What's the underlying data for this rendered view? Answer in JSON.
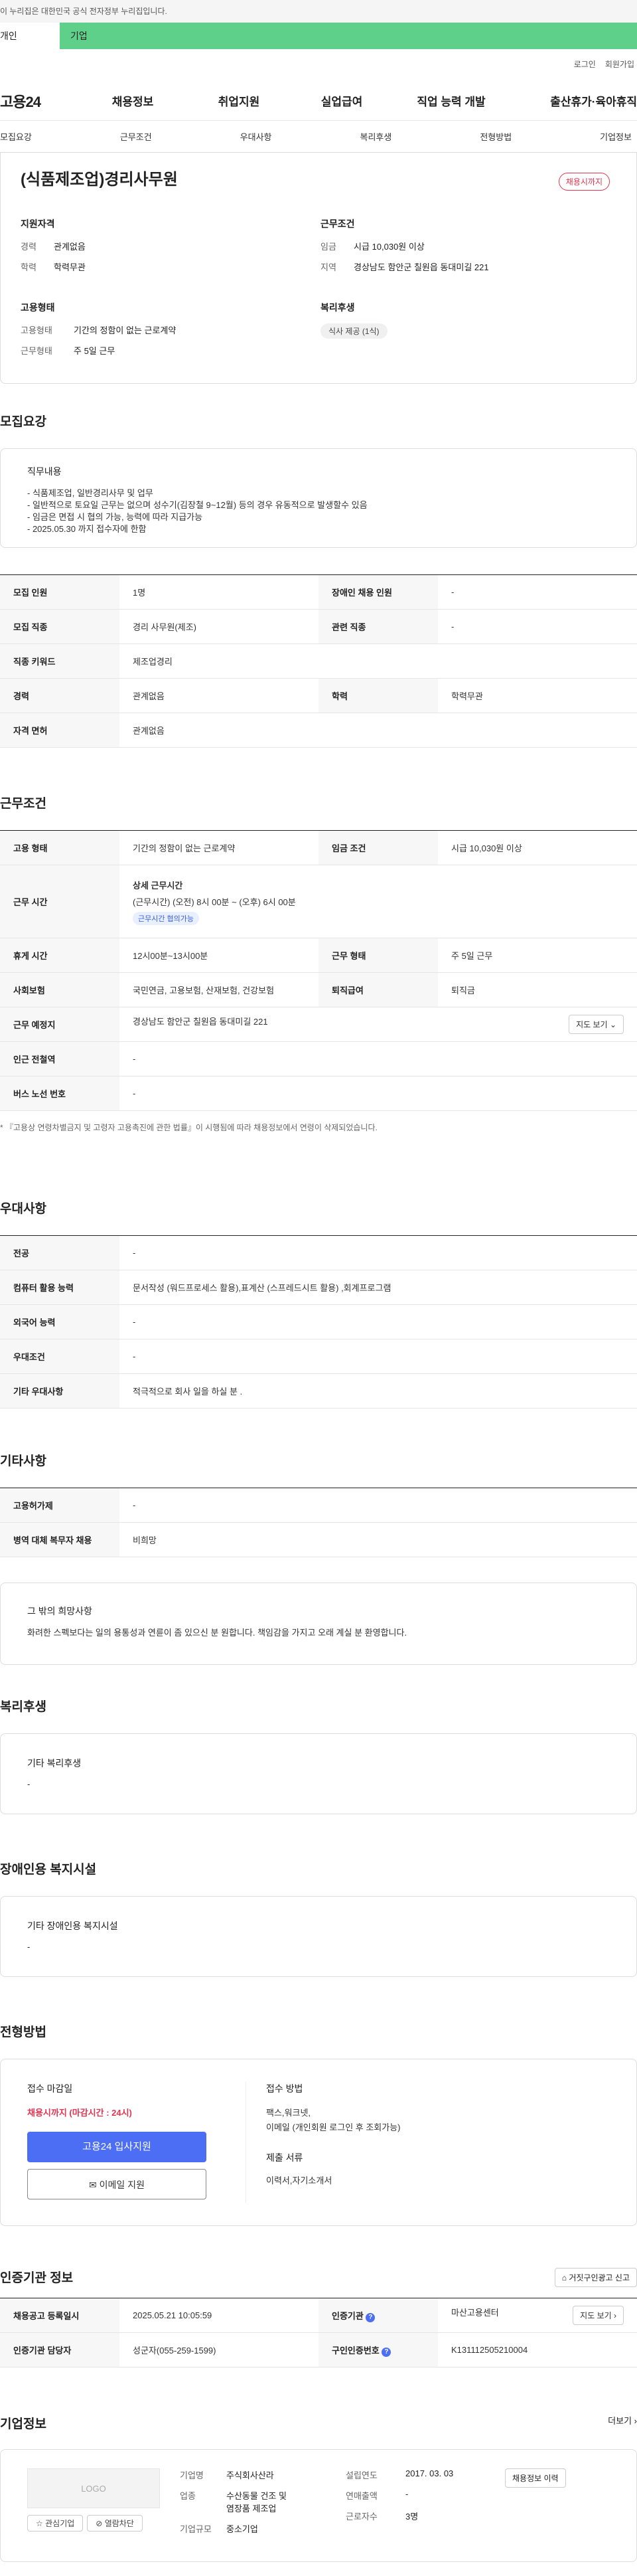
{
  "gov_banner": "이 누리집은 대한민국 공식 전자정부 누리집입니다.",
  "tabs": {
    "individual": "개인",
    "enterprise": "기업"
  },
  "util": {
    "login": "로그인",
    "join": "회원가입"
  },
  "gnb": {
    "logo": "고용24",
    "items": [
      "채용정보",
      "취업지원",
      "실업급여",
      "직업 능력 개발",
      "출산휴가·육아휴직"
    ]
  },
  "subnav": [
    "모집요강",
    "근무조건",
    "우대사항",
    "복리후생",
    "전형방법",
    "기업정보"
  ],
  "job": {
    "title": "(식품제조업)경리사무원",
    "badge": "채용시까지"
  },
  "summary": {
    "qual_h": "지원자격",
    "career_k": "경력",
    "career_v": "관계없음",
    "edu_k": "학력",
    "edu_v": "학력무관",
    "work_h": "근무조건",
    "wage_k": "임금",
    "wage_v": "시급 10,030원 이상",
    "area_k": "지역",
    "area_v": "경상남도 함안군 칠원읍 동대미길 221",
    "emp_h": "고용형태",
    "type_k": "고용형태",
    "type_v": "기간의 정함이 없는 근로계약",
    "form_k": "근무형태",
    "form_v": "주 5일 근무",
    "welfare_h": "복리후생",
    "welfare_chip": "식사 제공 (1식)"
  },
  "recruit": {
    "h": "모집요강",
    "duty_h": "직무내용",
    "duty_lines": [
      "- 식품제조업, 일반경리사무 및 업무",
      "- 일반적으로 토요일 근무는 없으며 성수기(김장철 9~12월) 등의 경우 유동적으로 발생할수 있음",
      "- 임금은 면접 시 협의 가능, 능력에 따라 지급가능",
      "- 2025.05.30 까지 접수자에 한함"
    ],
    "rows": [
      {
        "k1": "모집 인원",
        "v1": "1명",
        "k2": "장애인 채용 인원",
        "v2": "-"
      },
      {
        "k1": "모집 직종",
        "v1": "경리 사무원(제조)",
        "k2": "관련 직종",
        "v2": "-"
      },
      {
        "k1": "직종 키워드",
        "v1": "제조업경리"
      },
      {
        "k1": "경력",
        "v1": "관계없음",
        "k2": "학력",
        "v2": "학력무관"
      },
      {
        "k1": "자격 면허",
        "v1": "관계없음"
      }
    ]
  },
  "conditions": {
    "h": "근무조건",
    "type_k": "고용 형태",
    "type_v": "기간의 정함이 없는 근로계약",
    "wage_k": "임금 조건",
    "wage_v": "시급 10,030원 이상",
    "time_k": "근무 시간",
    "time_h": "상세 근무시간",
    "time_v": "(근무시간) (오전) 8시 00분 ~ (오후) 6시 00분",
    "time_chip": "근무시간 협의가능",
    "rest_k": "휴게 시간",
    "rest_v": "12시00분~13시00분",
    "form_k": "근무 형태",
    "form_v": "주 5일 근무",
    "ins_k": "사회보험",
    "ins_v": "국민연금, 고용보험, 산재보험, 건강보험",
    "ret_k": "퇴직급여",
    "ret_v": "퇴직금",
    "place_k": "근무 예정지",
    "place_v": "경상남도 함안군 칠원읍 동대미길 221",
    "map_btn": "지도 보기",
    "sub_k": "인근 전철역",
    "sub_v": "-",
    "bus_k": "버스 노선 번호",
    "bus_v": "-",
    "note": "* 『고용상 연령차별금지 및 고령자 고용촉진에 관한 법률』이 시행됨에 따라 채용정보에서 연령이 삭제되었습니다."
  },
  "pref": {
    "h": "우대사항",
    "rows": [
      {
        "k": "전공",
        "v": "-"
      },
      {
        "k": "컴퓨터 활용 능력",
        "v": "문서작성 (워드프로세스 활용),표계산 (스프레드시트 활용) ,회계프로그램"
      },
      {
        "k": "외국어 능력",
        "v": "-"
      },
      {
        "k": "우대조건",
        "v": "-"
      },
      {
        "k": "기타 우대사항",
        "v": "적극적으로 회사 일을 하실 분 ."
      }
    ]
  },
  "etc": {
    "h": "기타사항",
    "rows": [
      {
        "k": "고용허가제",
        "v": "-"
      },
      {
        "k": "병역 대체 복무자 채용",
        "v": "비희망"
      }
    ],
    "wish_h": "그 밖의 희망사항",
    "wish_v": "화려한 스펙보다는 일의 용통성과  연륜이 좀 있으신 분 원합니다. 책임감을 가지고 오래 계실 분 환영합니다."
  },
  "benefit": {
    "h": "복리후생",
    "box_h": "기타 복리후생",
    "box_v": "-"
  },
  "disability": {
    "h": "장애인용 복지시설",
    "box_h": "기타 장애인용 복지시설",
    "box_v": "-"
  },
  "selection": {
    "h": "전형방법",
    "deadline_h": "접수 마감일",
    "deadline_v": "채용시까지 (마감시간 : 24시)",
    "apply_btn": "고용24 입사지원",
    "email_btn": "이메일 지원",
    "method_h": "접수 방법",
    "method_v1": "팩스,워크넷,",
    "method_v2": "이메일 (개인회원 로그인 후 조회가능)",
    "docs_h": "제출 서류",
    "docs_v": "이력서,자기소개서"
  },
  "cert": {
    "h": "인증기관 정보",
    "report_btn": "거짓구인광고 신고",
    "reg_k": "채용공고 등록일시",
    "reg_v": "2025.05.21 10:05:59",
    "org_k": "인증기관",
    "org_v": "마산고용센터",
    "map_btn": "지도 보기",
    "mgr_k": "인증기관 담당자",
    "mgr_v": "성군자(055-259-1599)",
    "num_k": "구인인증번호",
    "num_v": "K131112505210004"
  },
  "company": {
    "h": "기업정보",
    "more": "더보기",
    "logo": "LOGO",
    "fav_btn": "관심기업",
    "block_btn": "열람차단",
    "name_k": "기업명",
    "name_v": "주식회사산라",
    "ind_k": "업종",
    "ind_v1": "수산동물 건조 및",
    "ind_v2": "염장품 제조업",
    "size_k": "기업규모",
    "size_v": "중소기업",
    "year_k": "설립연도",
    "year_v": "2017. 03. 03",
    "sales_k": "연매출액",
    "sales_v": "-",
    "emp_k": "근로자수",
    "emp_v": "3명",
    "hist_btn": "채용정보 이력"
  }
}
